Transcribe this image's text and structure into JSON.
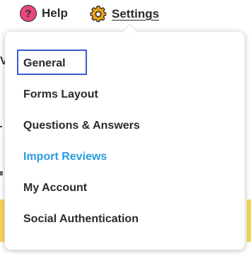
{
  "header": {
    "help_label": "Help",
    "help_icon": "help-circle-icon",
    "help_icon_glyph": "?",
    "settings_label": "Settings",
    "settings_icon": "gear-icon"
  },
  "settings_menu": {
    "items": [
      {
        "label": "General",
        "focused": true
      },
      {
        "label": "Forms Layout"
      },
      {
        "label": "Questions & Answers"
      },
      {
        "label": "Import Reviews",
        "active": true
      },
      {
        "label": "My Account"
      },
      {
        "label": "Social Authentication"
      }
    ]
  },
  "background": {
    "fragment_text": "V"
  },
  "colors": {
    "help_icon_bg": "#e8477a",
    "gear_icon": "#e9a21a",
    "active_item": "#2a9be0",
    "focus_ring": "#3a5bd0",
    "text": "#2b2b2b",
    "background_stripe": "#f6d35a"
  }
}
